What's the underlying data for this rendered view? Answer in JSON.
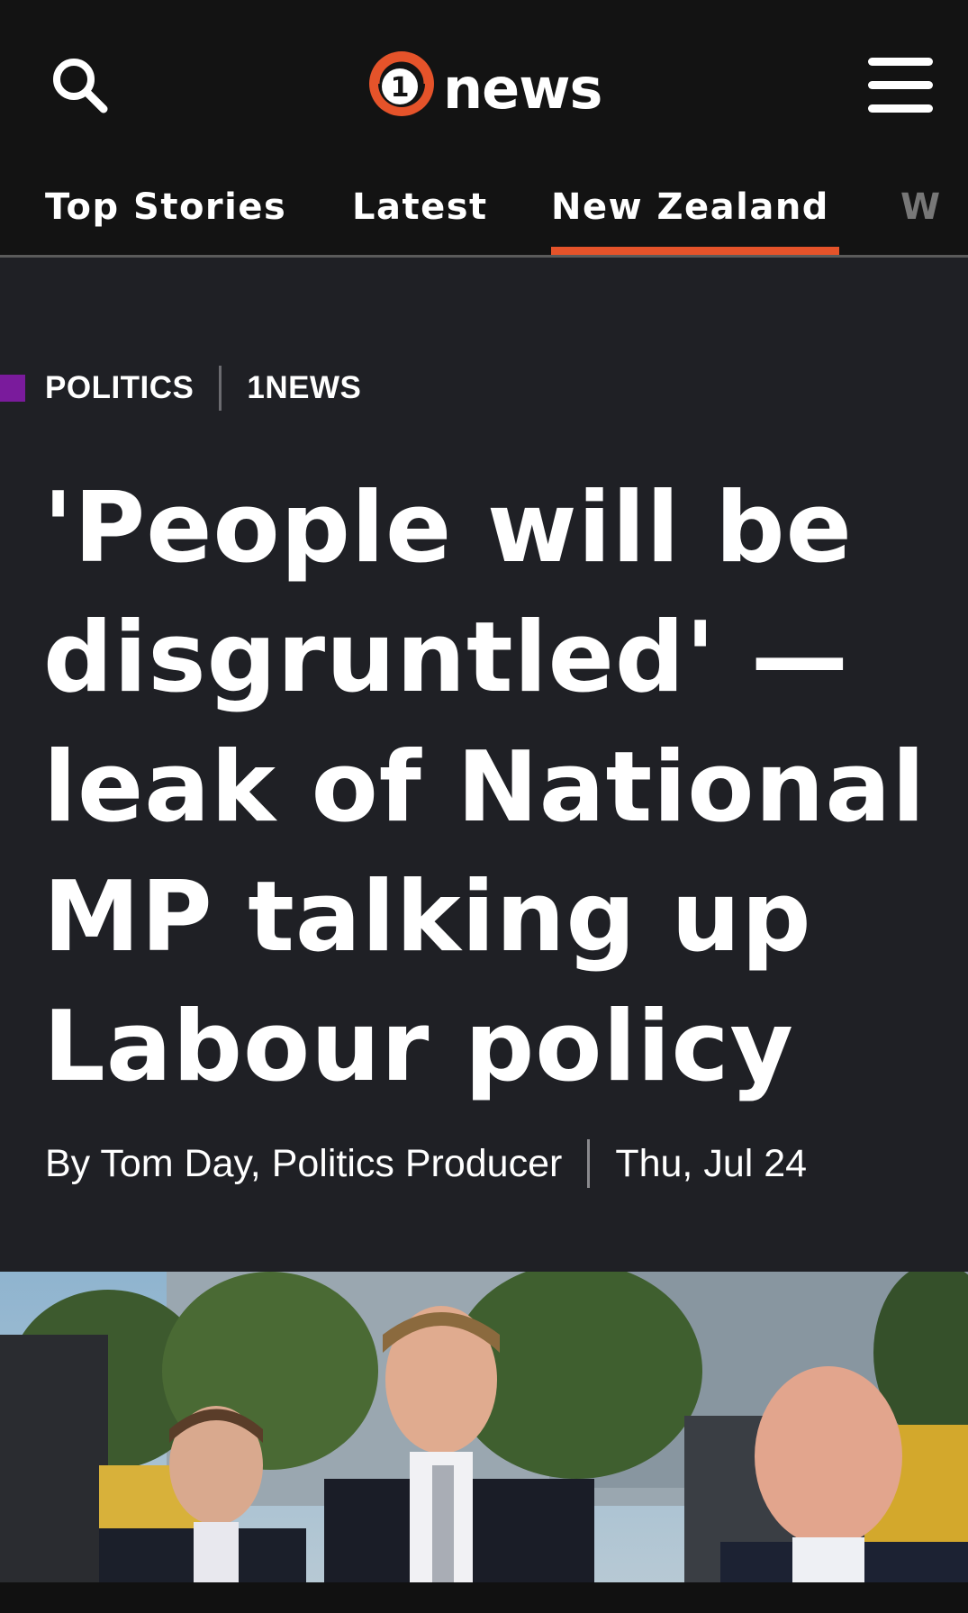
{
  "header": {
    "logo_text": "1news",
    "logo_number": "1",
    "icons": {
      "search": "search-icon",
      "menu": "hamburger-menu-icon"
    },
    "accent_color": "#e5532a"
  },
  "nav": {
    "tabs": [
      {
        "label": "Top Stories",
        "active": false
      },
      {
        "label": "Latest",
        "active": false
      },
      {
        "label": "New Zealand",
        "active": true
      },
      {
        "label": "W",
        "active": false
      }
    ]
  },
  "article": {
    "category": "POLITICS",
    "source": "1NEWS",
    "category_color": "#7a1b9c",
    "headline_lines": [
      "'People will be",
      "disgruntled' —",
      "leak of National",
      "MP talking up",
      "Labour policy"
    ],
    "byline": "By Tom Day, Politics Producer",
    "date": "Thu, Jul 24"
  },
  "hero_image": {
    "description_icon": "news-photo"
  }
}
